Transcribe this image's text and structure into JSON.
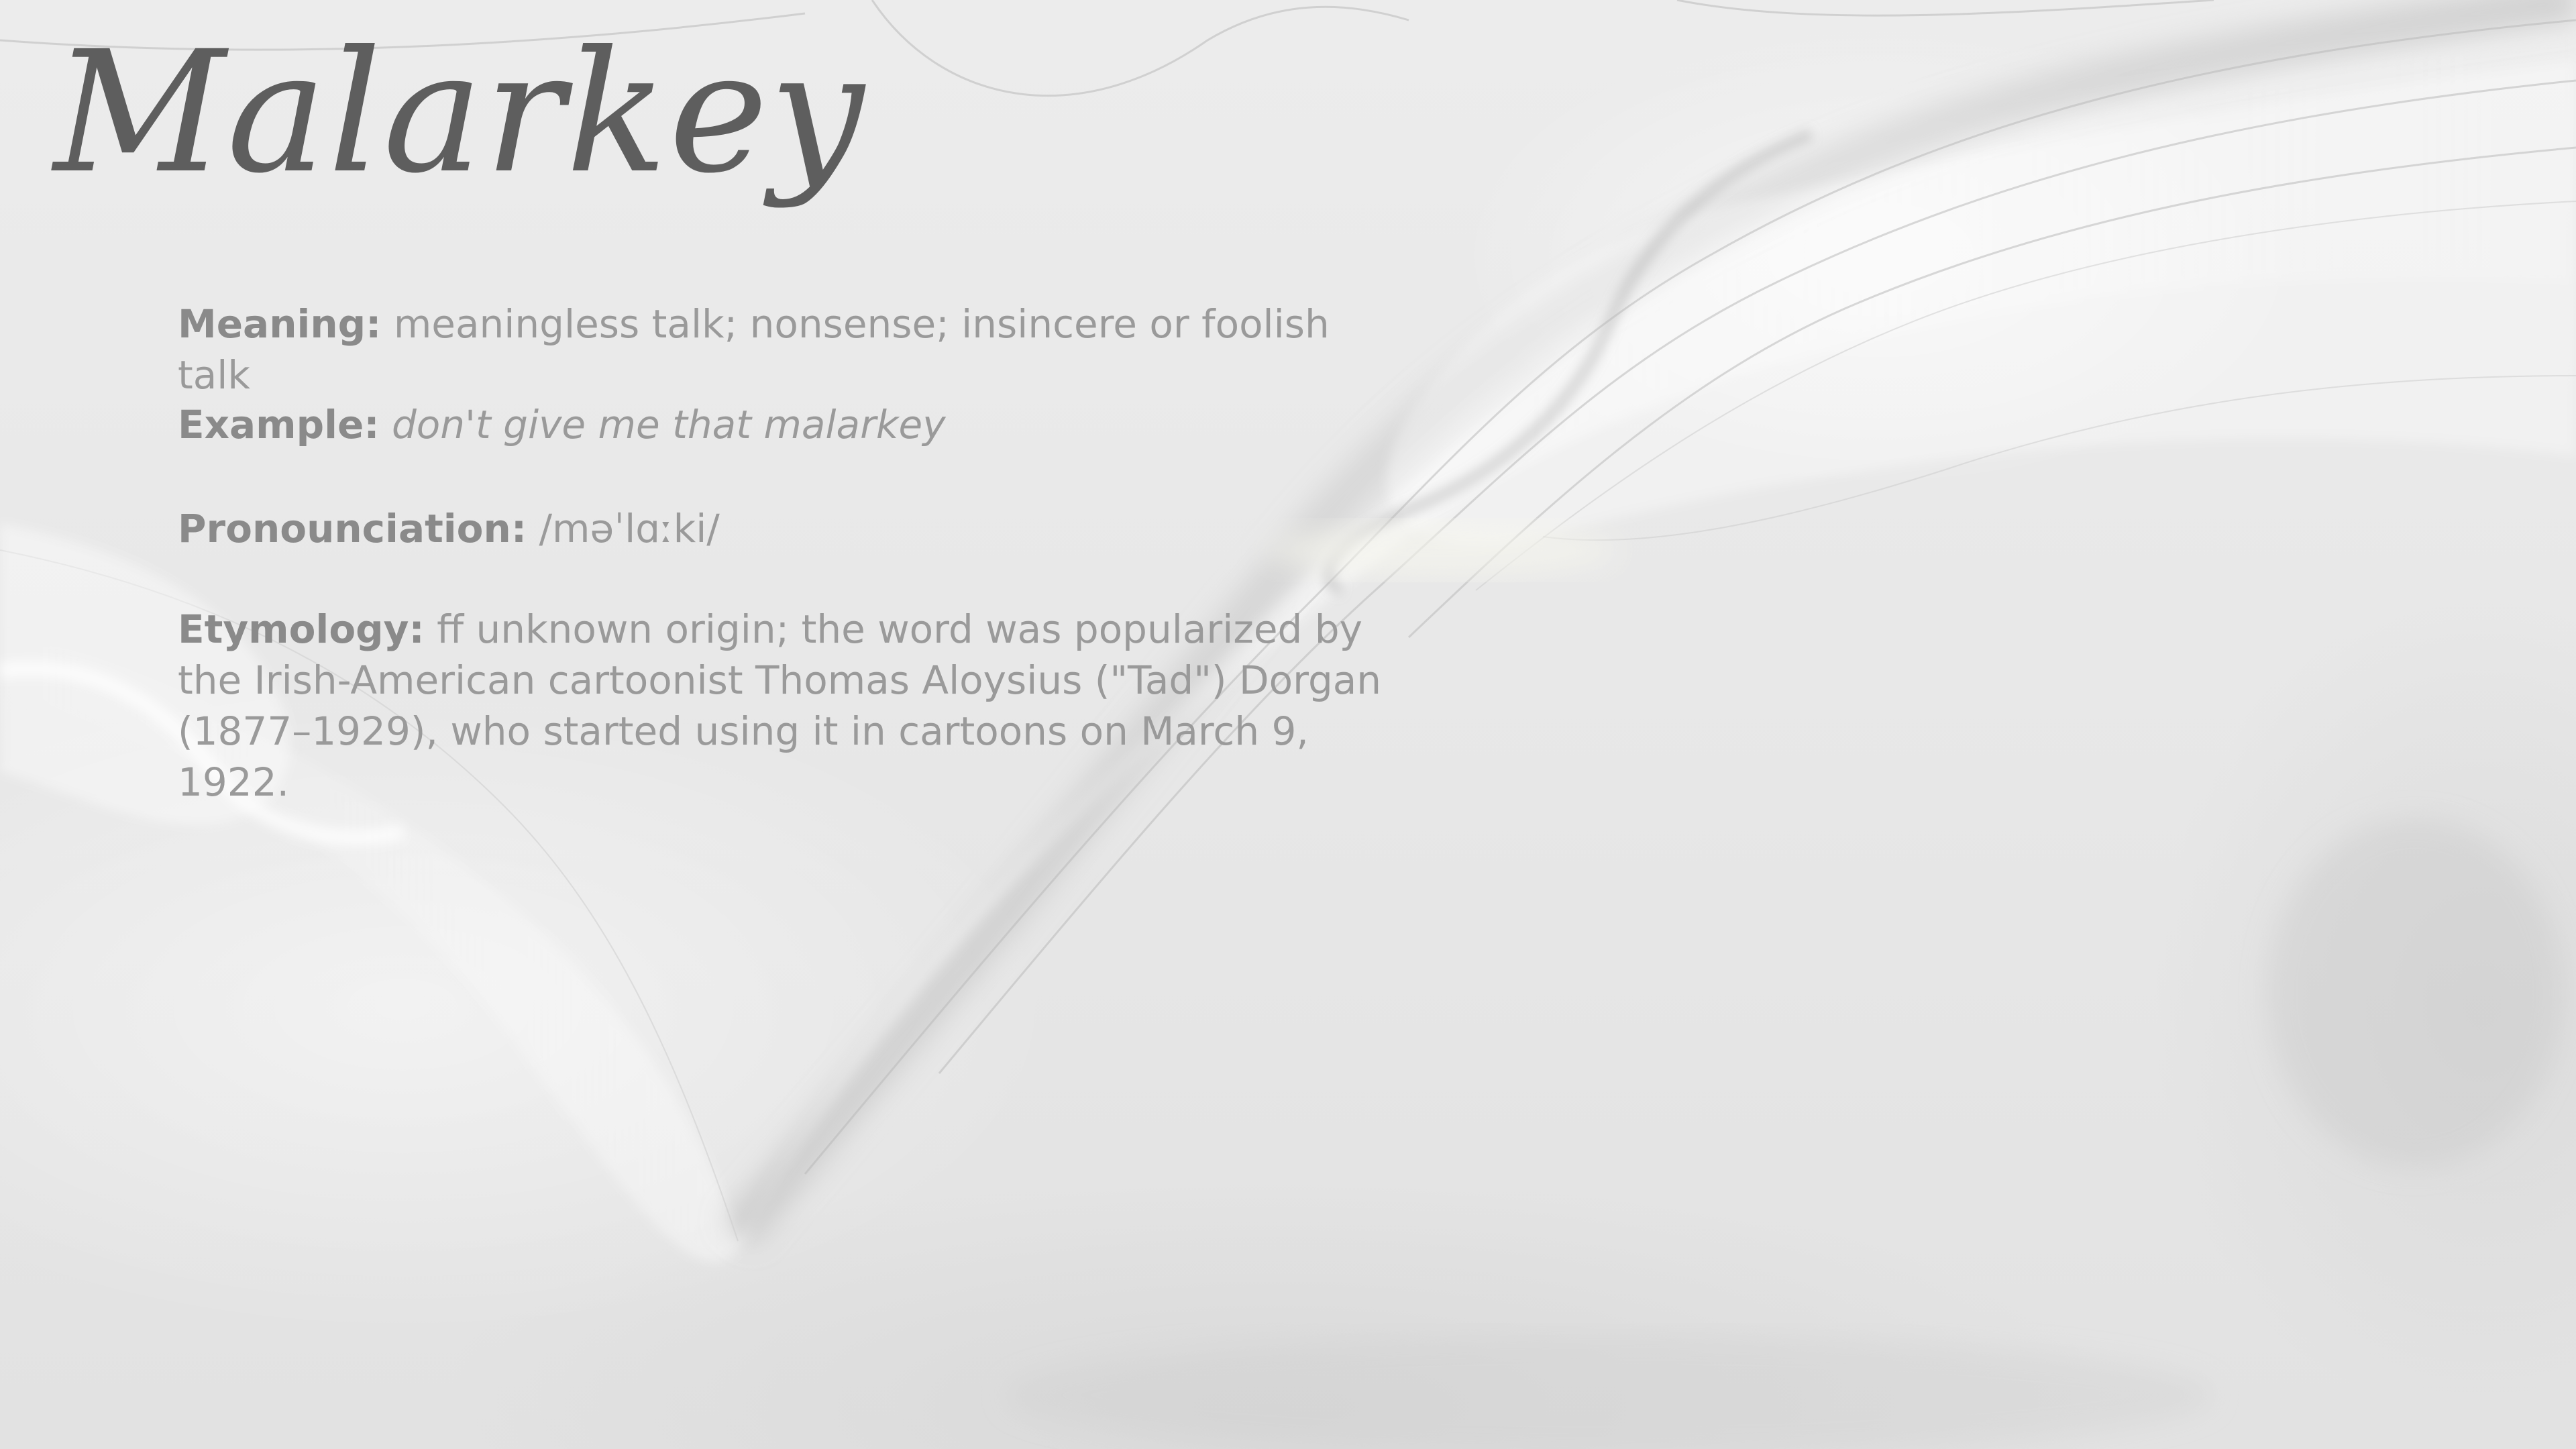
{
  "title": "Malarkey",
  "entries": {
    "meaning": {
      "label": "Meaning:",
      "value": "meaningless talk; nonsense; insincere or foolish talk"
    },
    "example": {
      "label": "Example:",
      "value": "don't give me that malarkey"
    },
    "pronunciation": {
      "label": "Pronounciation:",
      "value": "/məˈlɑːki/"
    },
    "etymology": {
      "label": "Etymology:",
      "value": "ff unknown origin; the word was popularized by the Irish-American cartoonist Thomas Aloysius (\"Tad\") Dorgan (1877–1929), who started using it in cartoons on March 9, 1922."
    }
  },
  "colors": {
    "title": "#5e5e5e",
    "label": "#8a8a8a",
    "text": "#9a9a9a",
    "background": "#e9e9e9"
  }
}
